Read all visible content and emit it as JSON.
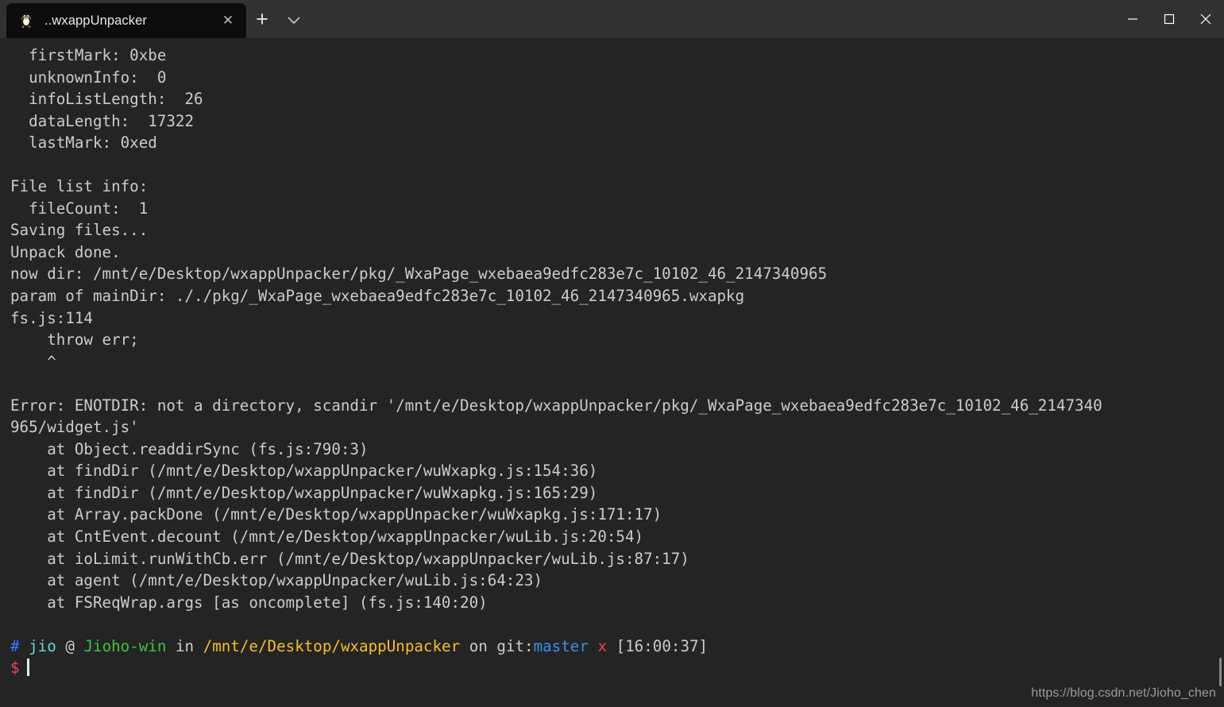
{
  "window": {
    "titlebar_bg": "#313131",
    "tab": {
      "icon_name": "tux-penguin-icon",
      "title": "..wxappUnpacker",
      "close_label": "✕"
    },
    "new_tab_label": "+",
    "tab_menu_label": "⌄",
    "controls": {
      "minimize": "minimize",
      "maximize": "maximize",
      "close": "close"
    }
  },
  "terminal": {
    "background": "#242424",
    "foreground": "#cccccc",
    "lines": [
      "  firstMark: 0xbe",
      "  unknownInfo:  0",
      "  infoListLength:  26",
      "  dataLength:  17322",
      "  lastMark: 0xed",
      "",
      "File list info:",
      "  fileCount:  1",
      "Saving files...",
      "Unpack done.",
      "now dir: /mnt/e/Desktop/wxappUnpacker/pkg/_WxaPage_wxebaea9edfc283e7c_10102_46_2147340965",
      "param of mainDir: ././pkg/_WxaPage_wxebaea9edfc283e7c_10102_46_2147340965.wxapkg",
      "fs.js:114",
      "    throw err;",
      "    ^",
      "",
      "Error: ENOTDIR: not a directory, scandir '/mnt/e/Desktop/wxappUnpacker/pkg/_WxaPage_wxebaea9edfc283e7c_10102_46_2147340",
      "965/widget.js'",
      "    at Object.readdirSync (fs.js:790:3)",
      "    at findDir (/mnt/e/Desktop/wxappUnpacker/wuWxapkg.js:154:36)",
      "    at findDir (/mnt/e/Desktop/wxappUnpacker/wuWxapkg.js:165:29)",
      "    at Array.packDone (/mnt/e/Desktop/wxappUnpacker/wuWxapkg.js:171:17)",
      "    at CntEvent.decount (/mnt/e/Desktop/wxappUnpacker/wuLib.js:20:54)",
      "    at ioLimit.runWithCb.err (/mnt/e/Desktop/wxappUnpacker/wuLib.js:87:17)",
      "    at agent (/mnt/e/Desktop/wxappUnpacker/wuLib.js:64:23)",
      "    at FSReqWrap.args [as oncomplete] (fs.js:140:20)",
      ""
    ],
    "prompt": {
      "hash": "#",
      "user": "jio",
      "at": "@",
      "host": "Jioho-win",
      "in": "in",
      "path": "/mnt/e/Desktop/wxappUnpacker",
      "on": "on",
      "git_label": "git:",
      "branch": "master",
      "dirty_flag": "x",
      "time": "[16:00:37]",
      "symbol": "$",
      "input": ""
    },
    "colors": {
      "hash": "#3b78ff",
      "user": "#61d6d6",
      "host": "#3fc13f",
      "path": "#f5bf26",
      "branch": "#3b8eea",
      "dirty": "#e74856",
      "dollar": "#e74856"
    }
  },
  "watermark": "https://blog.csdn.net/Jioho_chen"
}
